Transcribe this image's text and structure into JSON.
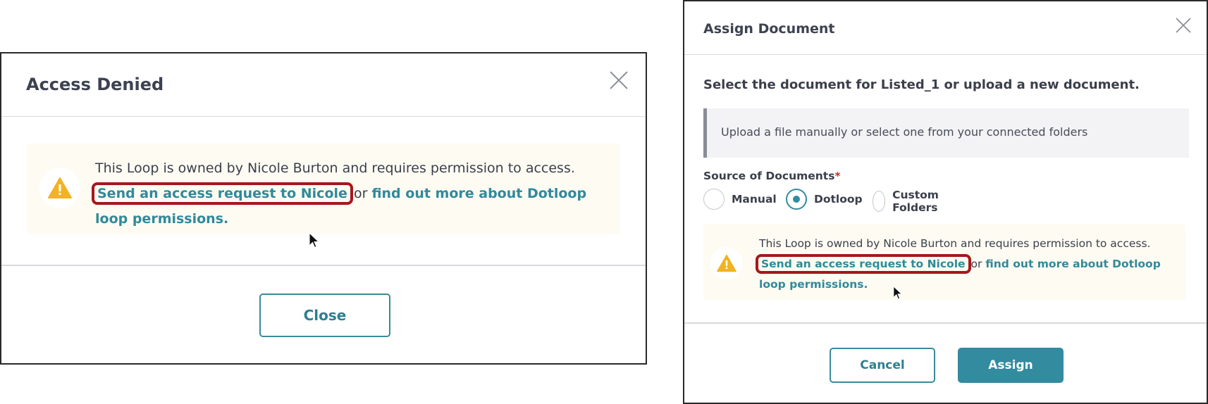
{
  "access_dialog": {
    "title": "Access Denied",
    "alert": {
      "message": "This Loop is owned by Nicole Burton and requires permission to access.",
      "request_link": "Send an access request to Nicole",
      "connector": "or",
      "learn_link": "find out more about Dotloop loop permissions."
    },
    "close_button": "Close"
  },
  "assign_dialog": {
    "title": "Assign Document",
    "prompt": "Select the document for Listed_1 or upload a new document.",
    "info_text": "Upload a file manually or select one from your connected folders",
    "source_label": "Source of Documents",
    "required_mark": "*",
    "source_options": [
      {
        "label": "Manual",
        "selected": false
      },
      {
        "label": "Dotloop",
        "selected": true
      },
      {
        "label": "Custom Folders",
        "selected": false
      }
    ],
    "alert": {
      "message": "This Loop is owned by Nicole Burton and requires permission to access.",
      "request_link": "Send an access request to Nicole",
      "connector": "or",
      "learn_link": "find out more about Dotloop loop permissions."
    },
    "cancel_button": "Cancel",
    "assign_button": "Assign"
  },
  "colors": {
    "accent": "#338b9f",
    "link": "#2f8a9b",
    "highlight_box": "#a5181b",
    "warning_icon": "#f2b322",
    "alert_bg": "#fefbf3"
  },
  "icons": [
    "close-icon",
    "warning-icon",
    "mouse-cursor-icon"
  ]
}
